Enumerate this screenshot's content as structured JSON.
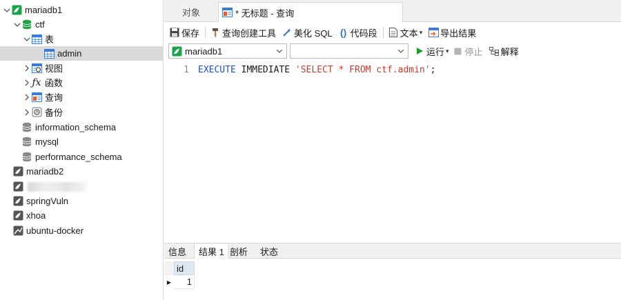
{
  "sidebar": {
    "connections": [
      {
        "label": "mariadb1",
        "expanded": true
      },
      {
        "label": "mariadb2",
        "expanded": false
      },
      {
        "label": "",
        "expanded": false,
        "obscured": true
      },
      {
        "label": "springVuln",
        "expanded": false
      },
      {
        "label": "xhoa",
        "expanded": false
      },
      {
        "label": "ubuntu-docker",
        "expanded": false
      }
    ],
    "database": {
      "label": "ctf"
    },
    "groups": {
      "tables": "表",
      "views": "视图",
      "functions": "函数",
      "queries": "查询",
      "backups": "备份"
    },
    "table_item": "admin",
    "other_databases": [
      "information_schema",
      "mysql",
      "performance_schema"
    ]
  },
  "tabs": {
    "objects": "对象",
    "query": "* 无标题 - 查询"
  },
  "toolbar": {
    "save": "保存",
    "query_builder": "查询创建工具",
    "beautify": "美化 SQL",
    "snippet": "代码段",
    "text": "文本",
    "export": "导出结果"
  },
  "selectors": {
    "connection": "mariadb1",
    "database": "",
    "run": "运行",
    "stop": "停止",
    "explain": "解释"
  },
  "editor": {
    "line_number": "1",
    "tokens": {
      "kw1": "EXECUTE",
      "kw2": "IMMEDIATE",
      "str": "'SELECT * FROM ctf.admin'",
      "end": ";"
    }
  },
  "result_tabs": [
    "信息",
    "结果 1",
    "剖析",
    "状态"
  ],
  "result_grid": {
    "columns": [
      "id"
    ],
    "rows": [
      [
        "1"
      ]
    ]
  },
  "colors": {
    "keyword": "#1f4fbf",
    "string": "#c43b2f",
    "selection": "#d9d9d9",
    "run_green": "#1a9e2f"
  }
}
